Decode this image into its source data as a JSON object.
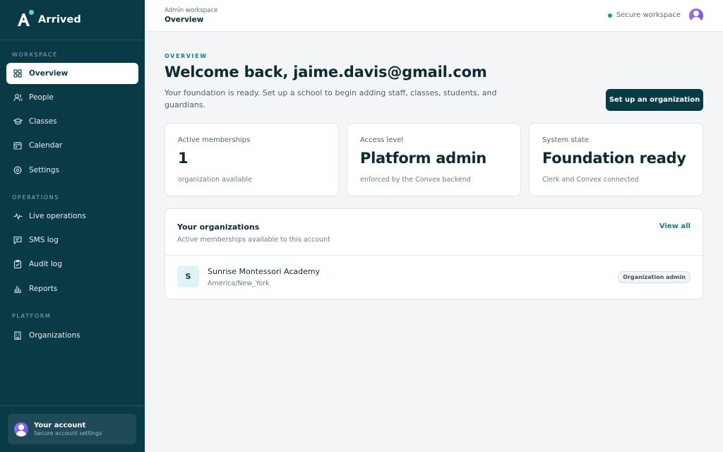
{
  "brand": {
    "name": "Arrived"
  },
  "sidebar": {
    "sections": [
      {
        "label": "WORKSPACE"
      },
      {
        "label": "OPERATIONS"
      },
      {
        "label": "PLATFORM"
      }
    ],
    "items": [
      {
        "label": "Overview",
        "icon": "grid-icon",
        "active": true
      },
      {
        "label": "People",
        "icon": "people-icon"
      },
      {
        "label": "Classes",
        "icon": "graduation-cap-icon"
      },
      {
        "label": "Calendar",
        "icon": "calendar-icon"
      },
      {
        "label": "Settings",
        "icon": "settings-icon"
      },
      {
        "label": "Live operations",
        "icon": "activity-icon"
      },
      {
        "label": "SMS log",
        "icon": "message-icon"
      },
      {
        "label": "Audit log",
        "icon": "clipboard-icon"
      },
      {
        "label": "Reports",
        "icon": "bar-chart-icon"
      },
      {
        "label": "Organizations",
        "icon": "building-icon"
      }
    ],
    "account": {
      "title": "Your account",
      "subtitle": "Secure account settings"
    }
  },
  "topbar": {
    "subtitle": "Admin workspace",
    "title": "Overview",
    "status": "Secure workspace",
    "status_color": "#1fa36b"
  },
  "main": {
    "eyebrow": "OVERVIEW",
    "heading": "Welcome back, jaime.davis@gmail.com",
    "intro": "Your foundation is ready. Set up a school to begin adding staff, classes, students, and guardians.",
    "cta_label": "Set up an organization",
    "stats": [
      {
        "label": "Active memberships",
        "value": "1",
        "note": "organization available"
      },
      {
        "label": "Access level",
        "value": "Platform admin",
        "note": "enforced by the Convex backend"
      },
      {
        "label": "System state",
        "value": "Foundation ready",
        "note": "Clerk and Convex connected"
      }
    ],
    "organizations": {
      "title": "Your organizations",
      "subtitle": "Active memberships available to this account",
      "view_all": "View all",
      "items": [
        {
          "initial": "S",
          "name": "Sunrise Montessori Academy",
          "timezone": "America/New_York",
          "role": "Organization admin"
        }
      ]
    }
  },
  "colors": {
    "sidebar": "#0b3a47",
    "accent": "#1b7a86",
    "background": "#f3f5f6"
  }
}
